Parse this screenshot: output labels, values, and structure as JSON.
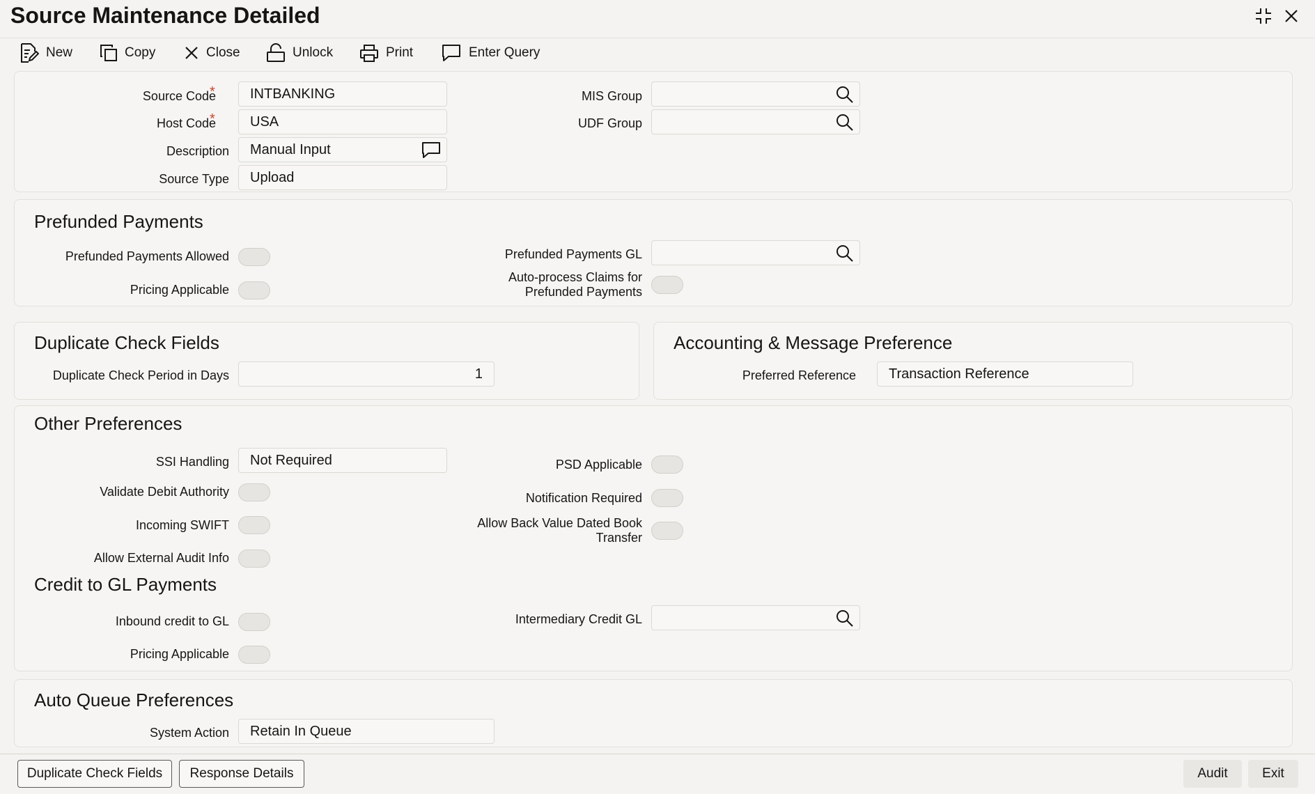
{
  "window": {
    "title": "Source Maintenance Detailed"
  },
  "toolbar": {
    "new": "New",
    "copy": "Copy",
    "close": "Close",
    "unlock": "Unlock",
    "print": "Print",
    "enter_query": "Enter Query"
  },
  "header_fields": {
    "source_code": {
      "label": "Source Code",
      "value": "INTBANKING",
      "required": "*"
    },
    "host_code": {
      "label": "Host Code",
      "value": "USA",
      "required": "*"
    },
    "description": {
      "label": "Description",
      "value": "Manual Input"
    },
    "source_type": {
      "label": "Source Type",
      "value": "Upload"
    },
    "mis_group": {
      "label": "MIS Group",
      "value": ""
    },
    "udf_group": {
      "label": "UDF Group",
      "value": ""
    }
  },
  "prefunded": {
    "title": "Prefunded Payments",
    "allowed_label": "Prefunded Payments Allowed",
    "pricing_label": "Pricing Applicable",
    "gl_label": "Prefunded Payments GL",
    "gl_value": "",
    "autoprocess_label_1": "Auto-process Claims for",
    "autoprocess_label_2": "Prefunded Payments"
  },
  "duplicate": {
    "title": "Duplicate Check Fields",
    "period_label": "Duplicate Check Period in Days",
    "period_value": "1"
  },
  "accounting": {
    "title": "Accounting & Message Preference",
    "preferred_label": "Preferred Reference",
    "preferred_value": "Transaction Reference"
  },
  "other": {
    "title": "Other Preferences",
    "ssi_label": "SSI Handling",
    "ssi_value": "Not Required",
    "validate_label": "Validate Debit Authority",
    "incoming_label": "Incoming SWIFT",
    "external_label": "Allow External Audit Info",
    "psd_label": "PSD Applicable",
    "notification_label": "Notification Required",
    "backvalue_label_1": "Allow Back Value Dated Book",
    "backvalue_label_2": "Transfer"
  },
  "credit_gl": {
    "title": "Credit to GL Payments",
    "inbound_label": "Inbound credit to GL",
    "pricing_label": "Pricing Applicable",
    "intermediary_label": "Intermediary Credit GL",
    "intermediary_value": ""
  },
  "auto_queue": {
    "title": "Auto Queue Preferences",
    "action_label": "System Action",
    "action_value": "Retain In Queue"
  },
  "footer": {
    "duplicate_button": "Duplicate Check Fields",
    "response_button": "Response Details",
    "audit_button": "Audit",
    "exit_button": "Exit"
  }
}
